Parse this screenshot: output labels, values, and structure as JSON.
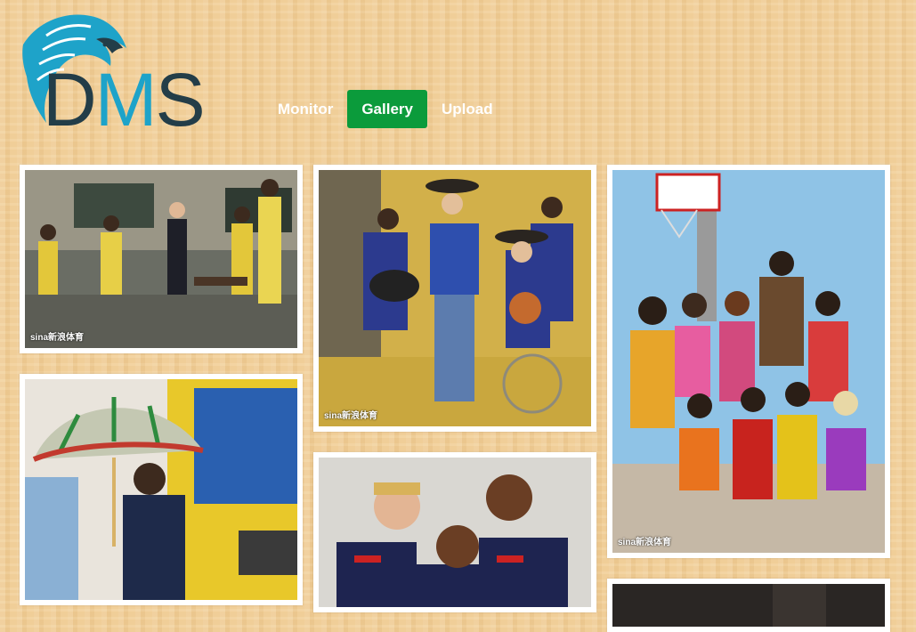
{
  "logo": {
    "letters": [
      "D",
      "M",
      "S"
    ],
    "icon": "eagle-icon"
  },
  "nav": [
    {
      "label": "Monitor",
      "active": false
    },
    {
      "label": "Gallery",
      "active": true
    },
    {
      "label": "Upload",
      "active": false
    }
  ],
  "gallery": {
    "photos": [
      {
        "subject": "classroom-team-photo",
        "watermark": "sina新浪体育"
      },
      {
        "subject": "dallas-players-cowboy-hats",
        "watermark": "sina新浪体育"
      },
      {
        "subject": "beach-group-photo",
        "watermark": "sina新浪体育"
      },
      {
        "subject": "player-with-umbrella",
        "watermark": ""
      },
      {
        "subject": "usa-team-players",
        "watermark": ""
      },
      {
        "subject": "dark-photo",
        "watermark": ""
      }
    ]
  },
  "colors": {
    "active_nav": "#0b9b3b",
    "logo_dark": "#233d48",
    "logo_teal": "#1ea3c9"
  }
}
